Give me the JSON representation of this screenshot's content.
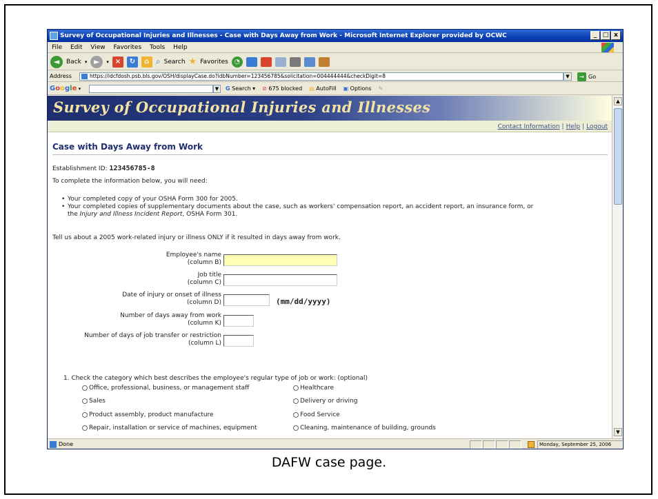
{
  "window": {
    "title": "Survey of Occupational Injuries and Illnesses - Case with Days Away from Work - Microsoft Internet Explorer provided by OCWC",
    "controls": [
      "_",
      "□",
      "x"
    ]
  },
  "menu": {
    "items": [
      "File",
      "Edit",
      "View",
      "Favorites",
      "Tools",
      "Help"
    ]
  },
  "toolbar": {
    "back_label": "Back",
    "search_label": "Search",
    "favorites_label": "Favorites"
  },
  "address": {
    "label": "Address",
    "url": "https://idcfdosh.psb.bls.gov/OSH/displayCase.do?idbNumber=123456785&solicitation=004444444&checkDigit=8",
    "go_label": "Go"
  },
  "google_toolbar": {
    "logo": [
      "G",
      "o",
      "o",
      "g",
      "l",
      "e"
    ],
    "search_label": "Search",
    "blocked_label": "675 blocked",
    "autofill_label": "AutoFill",
    "options_label": "Options"
  },
  "page": {
    "banner_title": "Survey of Occupational Injuries and Illnesses",
    "links": [
      "Contact Information",
      "Help",
      "Logout"
    ],
    "link_separator": "|",
    "heading": "Case with Days Away from Work",
    "establishment_label": "Establishment ID:",
    "establishment_id": "123456785-8",
    "intro": "To complete the information below, you will need:",
    "bullet_1": "Your completed copy of your OSHA Form 300 for 2005.",
    "bullet_2a": "Your completed copies of supplementary documents about the case, such as workers' compensation report, an accident report, an insurance form, or",
    "bullet_2b_pre": "the ",
    "bullet_2b_em": "Injury and Illness Incident Report",
    "bullet_2b_post": ", OSHA Form 301.",
    "tell_us": "Tell us about a 2005 work-related injury or illness ONLY if it resulted in days away from work.",
    "fields": [
      {
        "label": "Employee's name",
        "sub": "(column B)",
        "value": ""
      },
      {
        "label": "Job title",
        "sub": "(column C)",
        "value": ""
      },
      {
        "label": "Date of injury or onset of illness",
        "sub": "(column D)",
        "value": ""
      },
      {
        "label": "Number of days away from work",
        "sub": "(column K)",
        "value": ""
      },
      {
        "label": "Number of days of job transfer or restriction",
        "sub": "(column L)",
        "value": ""
      }
    ],
    "date_hint": "(mm/dd/yyyy)",
    "question_1": "1.  Check the category which best describes the employee's regular type of job or work: (optional)",
    "options_left": [
      "Office, professional, business, or management staff",
      "Sales",
      "Product assembly, product manufacture",
      "Repair, installation or service of machines, equipment"
    ],
    "options_right": [
      "Healthcare",
      "Delivery or driving",
      "Food Service",
      "Cleaning, maintenance of building, grounds"
    ]
  },
  "status": {
    "text": "Done",
    "date": "Monday, September 25, 2006"
  },
  "caption": "DAFW case page."
}
